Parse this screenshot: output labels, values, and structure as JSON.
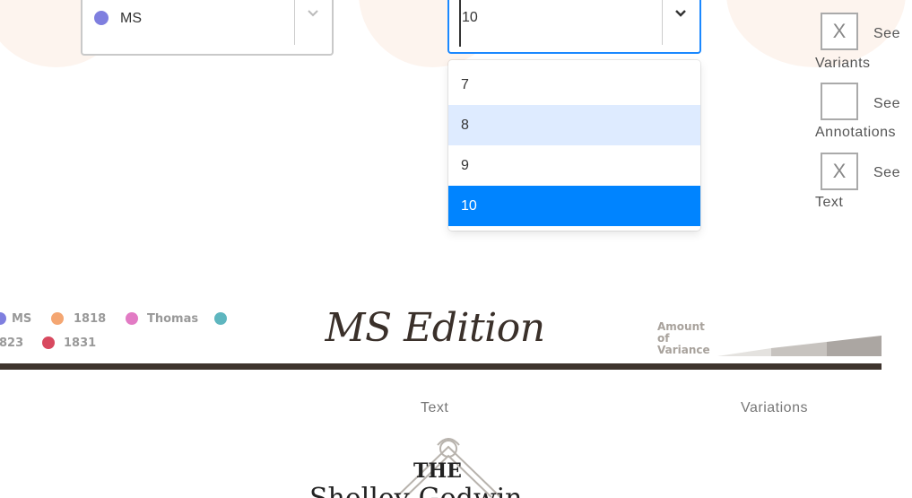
{
  "colors": {
    "accent_blue": "#0084ff",
    "focus_border": "#1a88ff",
    "option_hover": "#deebff",
    "rule": "#3e342d",
    "deco_circle": "#fdf4ee"
  },
  "edition_select": {
    "value": "MS",
    "dot_color": "#7f7fdf",
    "chevron_icon": "chevron-down-icon"
  },
  "page_select": {
    "value": "10",
    "chevron_icon": "chevron-down-icon",
    "options": [
      {
        "label": "7",
        "state": "normal"
      },
      {
        "label": "8",
        "state": "hover"
      },
      {
        "label": "9",
        "state": "normal"
      },
      {
        "label": "10",
        "state": "selected"
      }
    ]
  },
  "toggles": [
    {
      "see": "See",
      "label": "Variants",
      "checked": true,
      "mark": "X"
    },
    {
      "see": "See",
      "label": "Annotations",
      "checked": false,
      "mark": ""
    },
    {
      "see": "See",
      "label": "Text",
      "checked": true,
      "mark": "X"
    }
  ],
  "legend": [
    {
      "label": "MS",
      "color": "#7f7fdf"
    },
    {
      "label": "1818",
      "color": "#f4a672"
    },
    {
      "label": "Thomas",
      "color": "#e27bc4"
    },
    {
      "label": "",
      "color": "#5eb6bf"
    },
    {
      "label": "823",
      "color": ""
    },
    {
      "label": "1831",
      "color": "#d8495f"
    }
  ],
  "title": "MS Edition",
  "amount_of_variance": {
    "label_lines": [
      "Amount",
      "of",
      "Variance"
    ],
    "levels": [
      "#e4e2df",
      "#c7c3bf",
      "#aba6a2"
    ]
  },
  "columns": {
    "text": "Text",
    "variations": "Variations"
  },
  "book": {
    "the": "THE",
    "partial_title": "Shelley-Godwin"
  }
}
